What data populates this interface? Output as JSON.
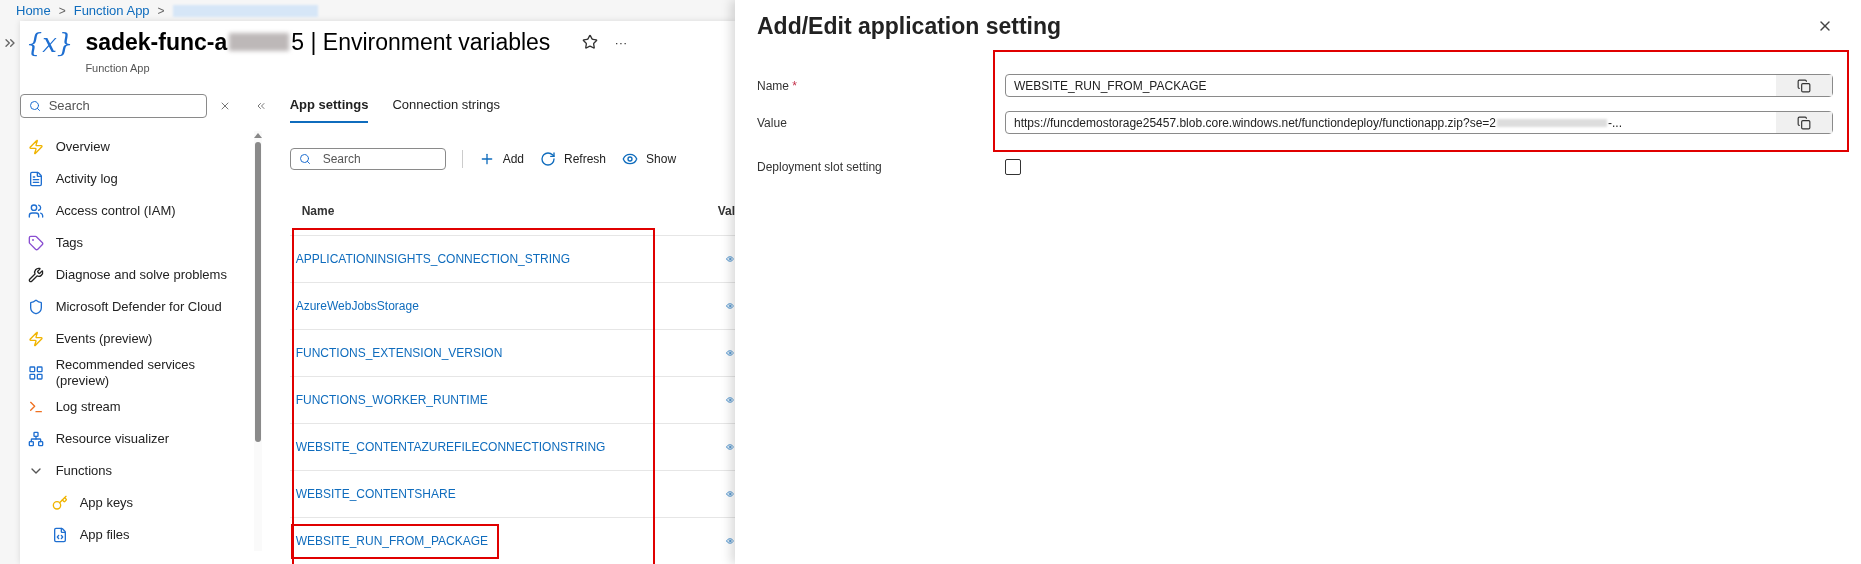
{
  "breadcrumb": {
    "items": [
      "Home",
      "Function App"
    ],
    "separator": ">"
  },
  "header": {
    "icon_text": "{x}",
    "title_start": "sadek-func-a",
    "title_end": "5 | Environment variables",
    "subtitle": "Function App",
    "more": "···"
  },
  "sidebar": {
    "search": {
      "placeholder": "Search"
    },
    "items": [
      {
        "label": "Overview"
      },
      {
        "label": "Activity log"
      },
      {
        "label": "Access control (IAM)"
      },
      {
        "label": "Tags"
      },
      {
        "label": "Diagnose and solve problems"
      },
      {
        "label": "Microsoft Defender for Cloud"
      },
      {
        "label": "Events (preview)"
      },
      {
        "label": "Recommended services (preview)"
      },
      {
        "label": "Log stream"
      },
      {
        "label": "Resource visualizer"
      },
      {
        "label": "Functions",
        "expanded": true,
        "children": [
          {
            "label": "App keys"
          },
          {
            "label": "App files"
          }
        ]
      }
    ]
  },
  "tabs": [
    {
      "label": "App settings",
      "selected": true
    },
    {
      "label": "Connection strings",
      "selected": false
    }
  ],
  "toolbar": {
    "search": {
      "placeholder": "Search"
    },
    "buttons": [
      "Add",
      "Refresh",
      "Show"
    ]
  },
  "table": {
    "columns": [
      "Name",
      "Val"
    ],
    "rows": [
      {
        "name": "APPLICATIONINSIGHTS_CONNECTION_STRING",
        "highlighted": false
      },
      {
        "name": "AzureWebJobsStorage",
        "highlighted": false
      },
      {
        "name": "FUNCTIONS_EXTENSION_VERSION",
        "highlighted": false
      },
      {
        "name": "FUNCTIONS_WORKER_RUNTIME",
        "highlighted": false
      },
      {
        "name": "WEBSITE_CONTENTAZUREFILECONNECTIONSTRING",
        "highlighted": false
      },
      {
        "name": "WEBSITE_CONTENTSHARE",
        "highlighted": false
      },
      {
        "name": "WEBSITE_RUN_FROM_PACKAGE",
        "highlighted": true
      }
    ]
  },
  "panel": {
    "title": "Add/Edit application setting",
    "name_field": {
      "label": "Name",
      "required_mark": "*",
      "value": "WEBSITE_RUN_FROM_PACKAGE"
    },
    "value_field": {
      "label": "Value",
      "value": "https://funcdemostorage25457.blob.core.windows.net/functiondeploy/functionapp.zip?se=2",
      "value_end": "-..."
    },
    "slot_setting": {
      "label": "Deployment slot setting",
      "checked": false
    }
  }
}
